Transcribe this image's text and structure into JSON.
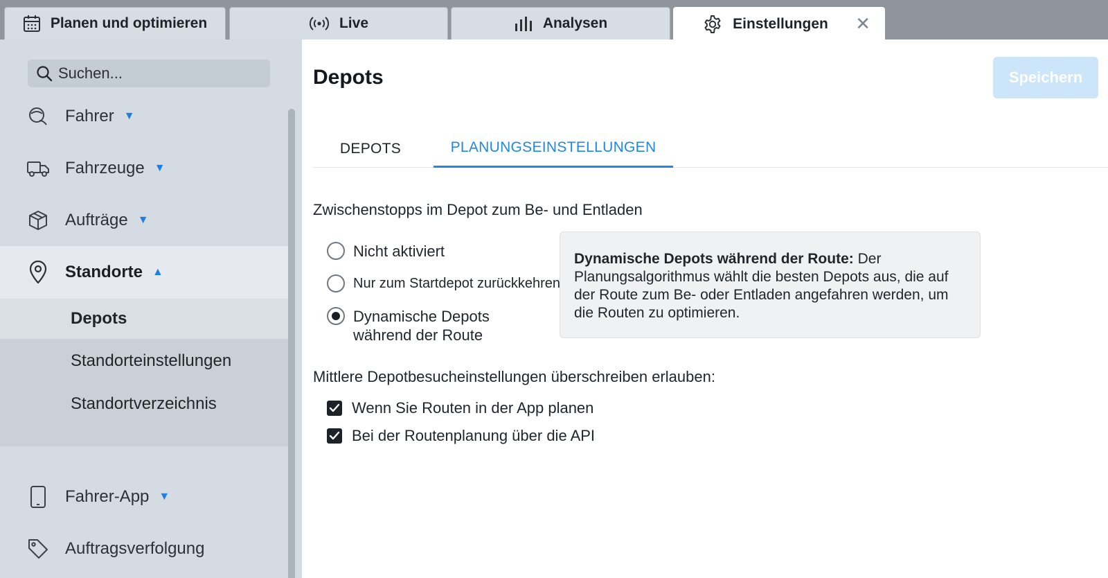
{
  "tabs": [
    {
      "label": "Planen und optimieren",
      "icon": "calendar-icon"
    },
    {
      "label": "Live",
      "icon": "broadcast-icon"
    },
    {
      "label": "Analysen",
      "icon": "bar-chart-icon"
    },
    {
      "label": "Einstellungen",
      "icon": "gear-icon",
      "active": true,
      "close": "✕"
    }
  ],
  "sidebar": {
    "search_placeholder": "Suchen...",
    "items": [
      {
        "label": "Fahrer",
        "icon": "driver-icon"
      },
      {
        "label": "Fahrzeuge",
        "icon": "truck-icon"
      },
      {
        "label": "Aufträge",
        "icon": "package-icon"
      },
      {
        "label": "Standorte",
        "icon": "location-pin-icon",
        "expanded": true
      },
      {
        "label": "Fahrer-App",
        "icon": "phone-icon"
      },
      {
        "label": "Auftragsverfolgung",
        "icon": "tag-icon"
      }
    ],
    "sub_items": [
      {
        "label": "Depots",
        "active": true
      },
      {
        "label": "Standorteinstellungen"
      },
      {
        "label": "Standortverzeichnis"
      }
    ]
  },
  "main": {
    "title": "Depots",
    "save_label": "Speichern",
    "tabs": [
      {
        "label": "DEPOTS"
      },
      {
        "label": "PLANUNGSEINSTELLUNGEN",
        "active": true
      }
    ],
    "section_heading": "Zwischenstopps im Depot zum Be- und Entladen",
    "radio_options": [
      {
        "label": "Nicht aktiviert",
        "selected": false
      },
      {
        "label": "Nur zum Startdepot zurückkehren",
        "selected": false
      },
      {
        "label_line1": "Dynamische Depots",
        "label_line2": "während der Route",
        "selected": true
      }
    ],
    "info": {
      "bold": "Dynamische Depots während der Route:",
      "text": "Der Planungsalgorithmus wählt die besten Depots aus, die auf der Route zum Be- oder Entladen angefahren werden, um die Routen zu optimieren."
    },
    "override_label": "Mittlere Depotbesucheinstellungen überschreiben erlauben:",
    "checkboxes": [
      {
        "label": "Wenn Sie Routen in der App planen",
        "checked": true
      },
      {
        "label": "Bei der Routenplanung über die API",
        "checked": true
      }
    ]
  },
  "colors": {
    "accent": "#1e88e5",
    "save_disabled": "#cce5f8"
  }
}
